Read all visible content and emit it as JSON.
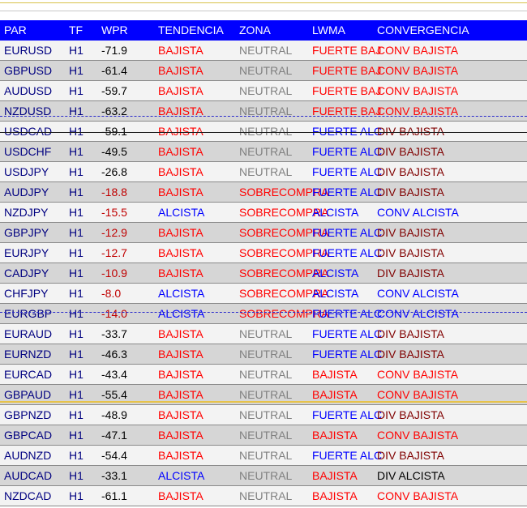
{
  "columns": {
    "par": "PAR",
    "tf": "TF",
    "wpr": "WPR",
    "tendencia": "TENDENCIA",
    "zona": "ZONA",
    "lwma": "LWMA",
    "convergencia": "CONVERGENCIA"
  },
  "colors": {
    "header_bg": "#0000ff",
    "row_bg_a": "#f3f3f3",
    "row_bg_b": "#d6d6d6",
    "navy": "#000080",
    "red": "#ff0000",
    "blue": "#0000ff",
    "gray": "#808080",
    "darkred": "#800000",
    "black": "#000000",
    "crimson": "#c00000"
  },
  "rows": [
    {
      "par": "EURUSD",
      "tf": "H1",
      "wpr": "-71.9",
      "tendencia": "BAJISTA",
      "zona": "NEUTRAL",
      "lwma": "FUERTE BAJ",
      "convergencia": "CONV BAJISTA",
      "wprColor": "black",
      "tendColor": "red",
      "zonaColor": "gray",
      "lwmaColor": "red",
      "convColor": "red"
    },
    {
      "par": "GBPUSD",
      "tf": "H1",
      "wpr": "-61.4",
      "tendencia": "BAJISTA",
      "zona": "NEUTRAL",
      "lwma": "FUERTE BAJ",
      "convergencia": "CONV BAJISTA",
      "wprColor": "black",
      "tendColor": "red",
      "zonaColor": "gray",
      "lwmaColor": "red",
      "convColor": "red"
    },
    {
      "par": "AUDUSD",
      "tf": "H1",
      "wpr": "-59.7",
      "tendencia": "BAJISTA",
      "zona": "NEUTRAL",
      "lwma": "FUERTE BAJ",
      "convergencia": "CONV BAJISTA",
      "wprColor": "black",
      "tendColor": "red",
      "zonaColor": "gray",
      "lwmaColor": "red",
      "convColor": "red"
    },
    {
      "par": "NZDUSD",
      "tf": "H1",
      "wpr": "-63.2",
      "tendencia": "BAJISTA",
      "zona": "NEUTRAL",
      "lwma": "FUERTE BAJ",
      "convergencia": "CONV BAJISTA",
      "wprColor": "black",
      "tendColor": "red",
      "zonaColor": "gray",
      "lwmaColor": "red",
      "convColor": "red"
    },
    {
      "par": "USDCAD",
      "tf": "H1",
      "wpr": "-59.1",
      "tendencia": "BAJISTA",
      "zona": "NEUTRAL",
      "lwma": "FUERTE ALC",
      "convergencia": "DIV BAJISTA",
      "wprColor": "black",
      "tendColor": "red",
      "zonaColor": "gray",
      "lwmaColor": "blue",
      "convColor": "darkred"
    },
    {
      "par": "USDCHF",
      "tf": "H1",
      "wpr": "-49.5",
      "tendencia": "BAJISTA",
      "zona": "NEUTRAL",
      "lwma": "FUERTE ALC",
      "convergencia": "DIV BAJISTA",
      "wprColor": "black",
      "tendColor": "red",
      "zonaColor": "gray",
      "lwmaColor": "blue",
      "convColor": "darkred"
    },
    {
      "par": "USDJPY",
      "tf": "H1",
      "wpr": "-26.8",
      "tendencia": "BAJISTA",
      "zona": "NEUTRAL",
      "lwma": "FUERTE ALC",
      "convergencia": "DIV BAJISTA",
      "wprColor": "black",
      "tendColor": "red",
      "zonaColor": "gray",
      "lwmaColor": "blue",
      "convColor": "darkred"
    },
    {
      "par": "AUDJPY",
      "tf": "H1",
      "wpr": "-18.8",
      "tendencia": "BAJISTA",
      "zona": "SOBRECOMPRA",
      "lwma": "FUERTE ALC",
      "convergencia": "DIV BAJISTA",
      "wprColor": "crimson",
      "tendColor": "red",
      "zonaColor": "red",
      "lwmaColor": "blue",
      "convColor": "darkred"
    },
    {
      "par": "NZDJPY",
      "tf": "H1",
      "wpr": "-15.5",
      "tendencia": "ALCISTA",
      "zona": "SOBRECOMPRA",
      "lwma": "ALCISTA",
      "convergencia": "CONV ALCISTA",
      "wprColor": "crimson",
      "tendColor": "blue",
      "zonaColor": "red",
      "lwmaColor": "blue",
      "convColor": "blue"
    },
    {
      "par": "GBPJPY",
      "tf": "H1",
      "wpr": "-12.9",
      "tendencia": "BAJISTA",
      "zona": "SOBRECOMPRA",
      "lwma": "FUERTE ALC",
      "convergencia": "DIV BAJISTA",
      "wprColor": "crimson",
      "tendColor": "red",
      "zonaColor": "red",
      "lwmaColor": "blue",
      "convColor": "darkred"
    },
    {
      "par": "EURJPY",
      "tf": "H1",
      "wpr": "-12.7",
      "tendencia": "BAJISTA",
      "zona": "SOBRECOMPRA",
      "lwma": "FUERTE ALC",
      "convergencia": "DIV BAJISTA",
      "wprColor": "crimson",
      "tendColor": "red",
      "zonaColor": "red",
      "lwmaColor": "blue",
      "convColor": "darkred"
    },
    {
      "par": "CADJPY",
      "tf": "H1",
      "wpr": "-10.9",
      "tendencia": "BAJISTA",
      "zona": "SOBRECOMPRA",
      "lwma": "ALCISTA",
      "convergencia": "DIV BAJISTA",
      "wprColor": "crimson",
      "tendColor": "red",
      "zonaColor": "red",
      "lwmaColor": "blue",
      "convColor": "darkred"
    },
    {
      "par": "CHFJPY",
      "tf": "H1",
      "wpr": "-8.0",
      "tendencia": "ALCISTA",
      "zona": "SOBRECOMPRA",
      "lwma": "ALCISTA",
      "convergencia": "CONV ALCISTA",
      "wprColor": "crimson",
      "tendColor": "blue",
      "zonaColor": "red",
      "lwmaColor": "blue",
      "convColor": "blue"
    },
    {
      "par": "EURGBP",
      "tf": "H1",
      "wpr": "-14.0",
      "tendencia": "ALCISTA",
      "zona": "SOBRECOMPRA",
      "lwma": "FUERTE ALC",
      "convergencia": "CONV ALCISTA",
      "wprColor": "crimson",
      "tendColor": "blue",
      "zonaColor": "red",
      "lwmaColor": "blue",
      "convColor": "blue"
    },
    {
      "par": "EURAUD",
      "tf": "H1",
      "wpr": "-33.7",
      "tendencia": "BAJISTA",
      "zona": "NEUTRAL",
      "lwma": "FUERTE ALC",
      "convergencia": "DIV BAJISTA",
      "wprColor": "black",
      "tendColor": "red",
      "zonaColor": "gray",
      "lwmaColor": "blue",
      "convColor": "darkred"
    },
    {
      "par": "EURNZD",
      "tf": "H1",
      "wpr": "-46.3",
      "tendencia": "BAJISTA",
      "zona": "NEUTRAL",
      "lwma": "FUERTE ALC",
      "convergencia": "DIV BAJISTA",
      "wprColor": "black",
      "tendColor": "red",
      "zonaColor": "gray",
      "lwmaColor": "blue",
      "convColor": "darkred"
    },
    {
      "par": "EURCAD",
      "tf": "H1",
      "wpr": "-43.4",
      "tendencia": "BAJISTA",
      "zona": "NEUTRAL",
      "lwma": "BAJISTA",
      "convergencia": "CONV BAJISTA",
      "wprColor": "black",
      "tendColor": "red",
      "zonaColor": "gray",
      "lwmaColor": "red",
      "convColor": "red"
    },
    {
      "par": "GBPAUD",
      "tf": "H1",
      "wpr": "-55.4",
      "tendencia": "BAJISTA",
      "zona": "NEUTRAL",
      "lwma": "BAJISTA",
      "convergencia": "CONV BAJISTA",
      "wprColor": "black",
      "tendColor": "red",
      "zonaColor": "gray",
      "lwmaColor": "red",
      "convColor": "red"
    },
    {
      "par": "GBPNZD",
      "tf": "H1",
      "wpr": "-48.9",
      "tendencia": "BAJISTA",
      "zona": "NEUTRAL",
      "lwma": "FUERTE ALC",
      "convergencia": "DIV BAJISTA",
      "wprColor": "black",
      "tendColor": "red",
      "zonaColor": "gray",
      "lwmaColor": "blue",
      "convColor": "darkred"
    },
    {
      "par": "GBPCAD",
      "tf": "H1",
      "wpr": "-47.1",
      "tendencia": "BAJISTA",
      "zona": "NEUTRAL",
      "lwma": "BAJISTA",
      "convergencia": "CONV BAJISTA",
      "wprColor": "black",
      "tendColor": "red",
      "zonaColor": "gray",
      "lwmaColor": "red",
      "convColor": "red"
    },
    {
      "par": "AUDNZD",
      "tf": "H1",
      "wpr": "-54.4",
      "tendencia": "BAJISTA",
      "zona": "NEUTRAL",
      "lwma": "FUERTE ALC",
      "convergencia": "DIV BAJISTA",
      "wprColor": "black",
      "tendColor": "red",
      "zonaColor": "gray",
      "lwmaColor": "blue",
      "convColor": "darkred"
    },
    {
      "par": "AUDCAD",
      "tf": "H1",
      "wpr": "-33.1",
      "tendencia": "ALCISTA",
      "zona": "NEUTRAL",
      "lwma": "BAJISTA",
      "convergencia": "DIV ALCISTA",
      "wprColor": "black",
      "tendColor": "blue",
      "zonaColor": "gray",
      "lwmaColor": "red",
      "convColor": "black"
    },
    {
      "par": "NZDCAD",
      "tf": "H1",
      "wpr": "-61.1",
      "tendencia": "BAJISTA",
      "zona": "NEUTRAL",
      "lwma": "BAJISTA",
      "convergencia": "CONV BAJISTA",
      "wprColor": "black",
      "tendColor": "red",
      "zonaColor": "gray",
      "lwmaColor": "red",
      "convColor": "red"
    }
  ]
}
